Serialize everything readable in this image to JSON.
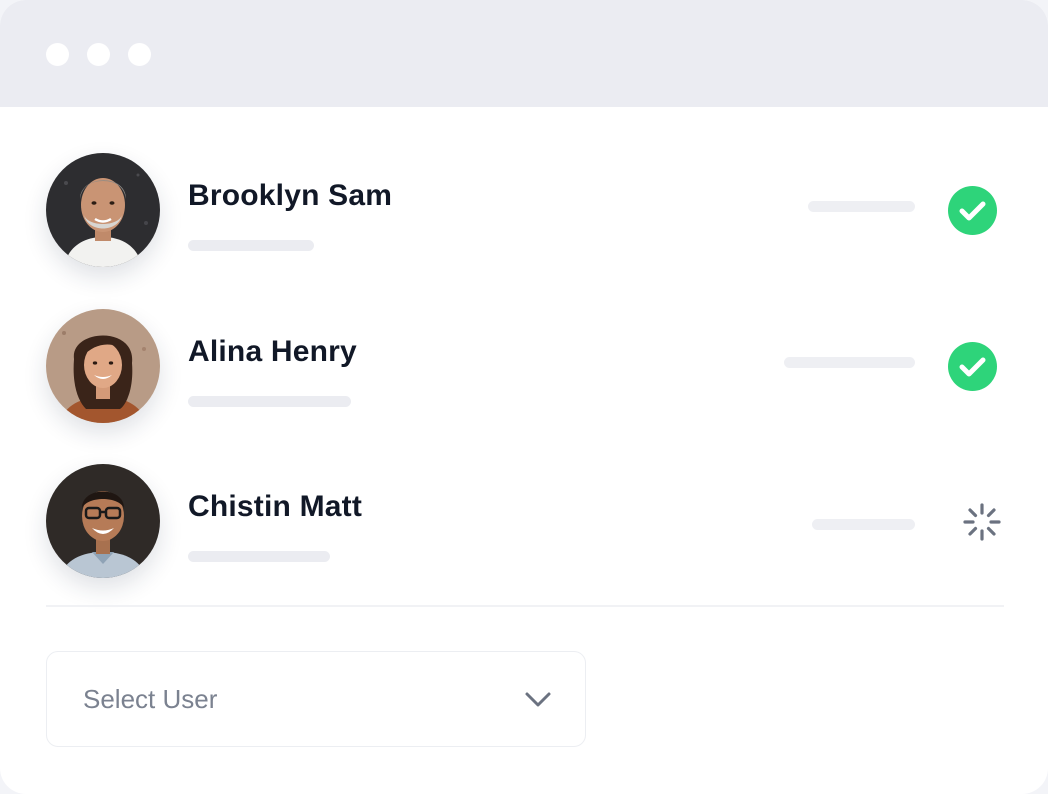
{
  "window": {
    "controls": [
      "window-dot",
      "window-dot",
      "window-dot"
    ]
  },
  "users": [
    {
      "name": "Brooklyn Sam",
      "status": "completed",
      "status_icon": "check-circle-icon"
    },
    {
      "name": "Alina Henry",
      "status": "completed",
      "status_icon": "check-circle-icon"
    },
    {
      "name": "Chistin Matt",
      "status": "loading",
      "status_icon": "spinner-icon"
    }
  ],
  "select": {
    "value": "Select User",
    "icon": "chevron-down-icon"
  },
  "colors": {
    "success": "#2ed47a",
    "titlebar": "#ebecf2",
    "text": "#111827",
    "muted_text": "#7b8290"
  }
}
